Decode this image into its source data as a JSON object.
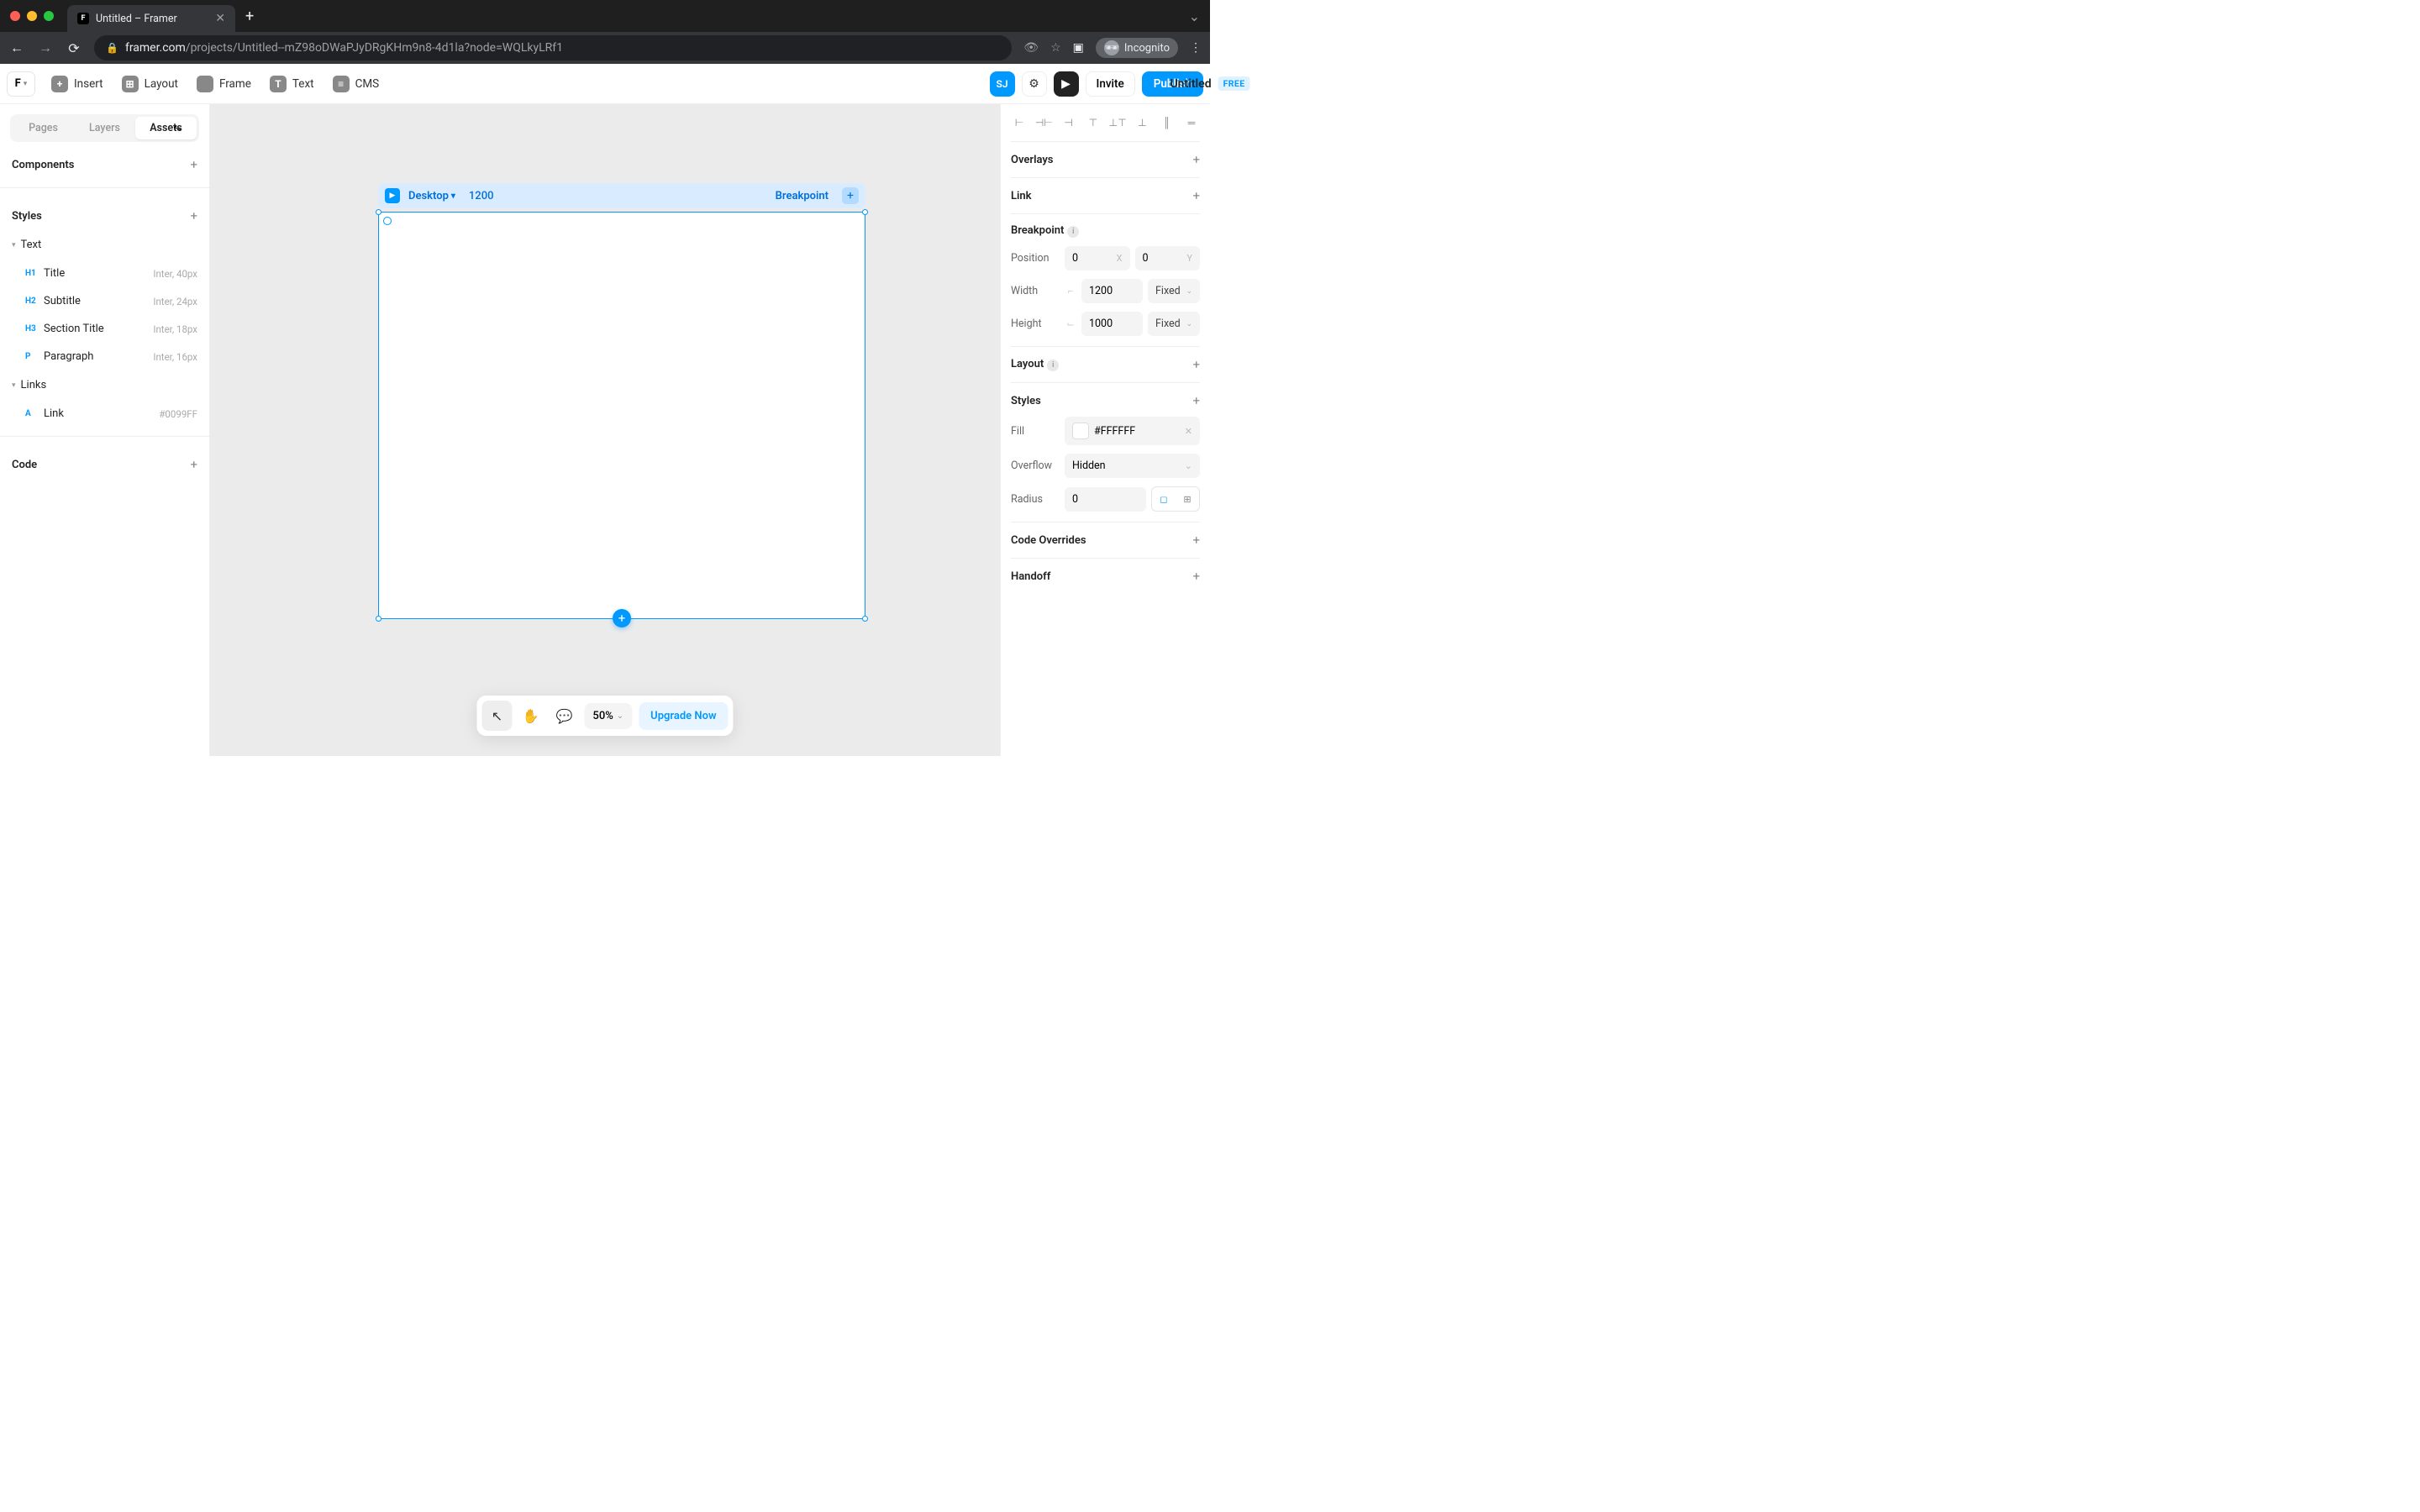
{
  "browser": {
    "tab_title": "Untitled – Framer",
    "url_domain": "framer.com",
    "url_path": "/projects/Untitled--mZ98oDWaPJyDRgKHm9n8-4d1la?node=WQLkyLRf1",
    "incognito_label": "Incognito"
  },
  "toolbar": {
    "insert": "Insert",
    "layout": "Layout",
    "frame": "Frame",
    "text": "Text",
    "cms": "CMS",
    "doc_title": "Untitled",
    "free_badge": "FREE",
    "avatar_initials": "SJ",
    "invite": "Invite",
    "publish": "Publish"
  },
  "left_panel": {
    "tabs": {
      "pages": "Pages",
      "layers": "Layers",
      "assets": "Assets",
      "active": "assets"
    },
    "components_label": "Components",
    "styles_label": "Styles",
    "text_group": "Text",
    "links_group": "Links",
    "code_label": "Code",
    "text_styles": [
      {
        "tag": "H1",
        "name": "Title",
        "detail": "Inter, 40px"
      },
      {
        "tag": "H2",
        "name": "Subtitle",
        "detail": "Inter, 24px"
      },
      {
        "tag": "H3",
        "name": "Section Title",
        "detail": "Inter, 18px"
      },
      {
        "tag": "P",
        "name": "Paragraph",
        "detail": "Inter, 16px"
      }
    ],
    "link_styles": [
      {
        "tag": "A",
        "name": "Link",
        "detail": "#0099FF"
      }
    ]
  },
  "canvas": {
    "device_label": "Desktop",
    "device_width": "1200",
    "breakpoint_label": "Breakpoint"
  },
  "bottombar": {
    "zoom": "50%",
    "upgrade": "Upgrade Now"
  },
  "right_panel": {
    "overlays": "Overlays",
    "link": "Link",
    "breakpoint": "Breakpoint",
    "position_label": "Position",
    "pos_x": "0",
    "pos_y": "0",
    "width_label": "Width",
    "width_val": "1200",
    "width_mode": "Fixed",
    "height_label": "Height",
    "height_val": "1000",
    "height_mode": "Fixed",
    "layout": "Layout",
    "styles": "Styles",
    "fill_label": "Fill",
    "fill_val": "#FFFFFF",
    "overflow_label": "Overflow",
    "overflow_val": "Hidden",
    "radius_label": "Radius",
    "radius_val": "0",
    "code_overrides": "Code Overrides",
    "handoff": "Handoff"
  }
}
